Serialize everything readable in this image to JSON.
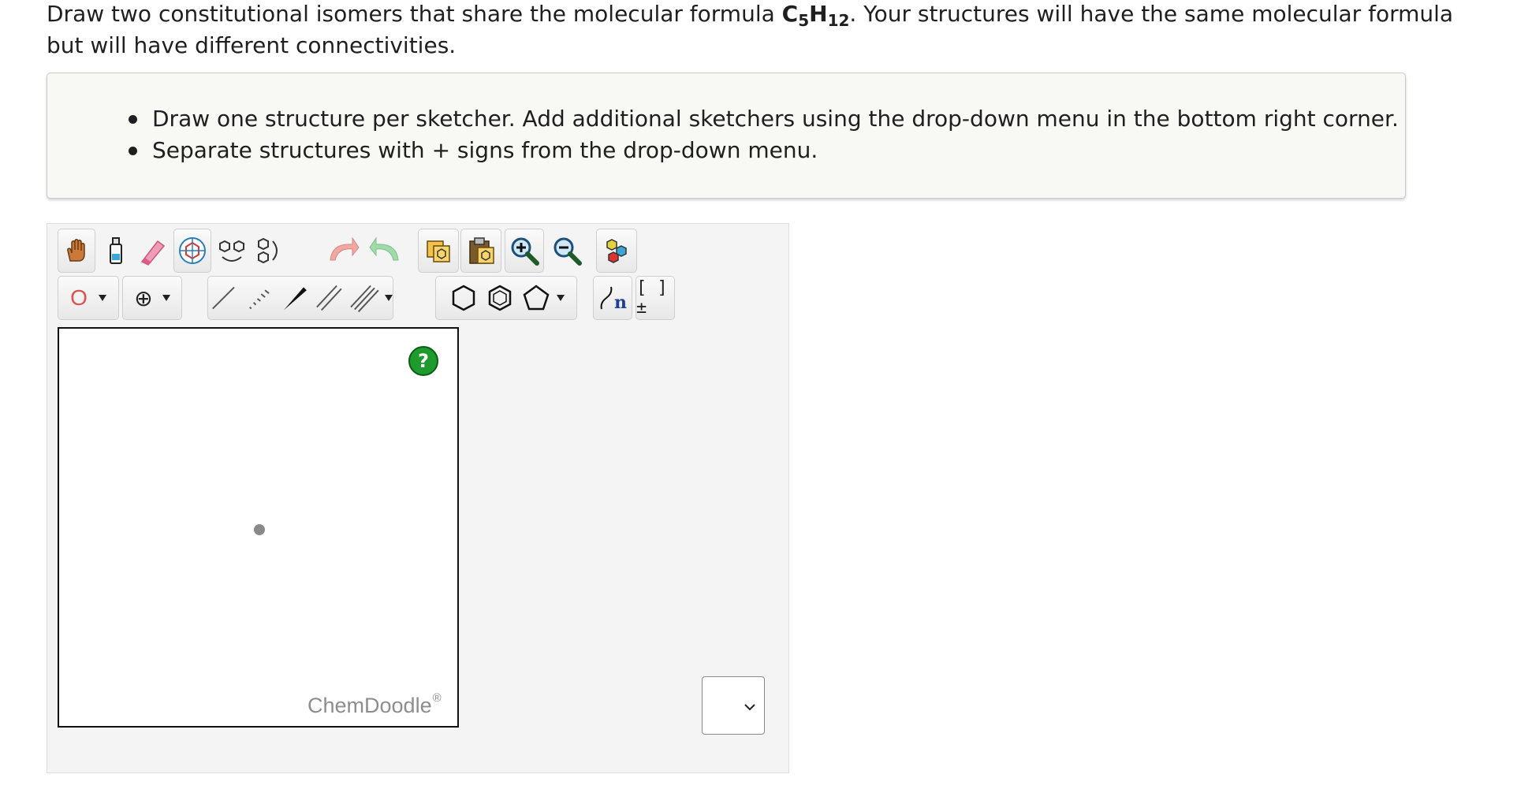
{
  "question": {
    "part1": "Draw two constitutional isomers that share the molecular formula ",
    "formula_c": "C",
    "formula_c_sub": "5",
    "formula_h": "H",
    "formula_h_sub": "12",
    "part2": ". Your structures will have the same molecular formula but will have different connectivities."
  },
  "instructions": [
    "Draw one structure per sketcher. Add additional sketchers using the drop-down menu in the bottom right corner.",
    "Separate structures with + signs from the drop-down menu."
  ],
  "toolbar": {
    "row1": [
      "hand-icon",
      "lasso-bottle-icon",
      "eraser-icon",
      "ring-template-icon",
      "chain-templates-icon",
      "rotate-chain-icon",
      "undo-icon",
      "redo-icon",
      "copy-icon",
      "paste-icon",
      "zoom-in-icon",
      "zoom-out-icon",
      "clean-structure-icon"
    ],
    "atom_label": "O",
    "atom_color": "#d9534f",
    "charge_label": "⊕",
    "bracket_label": "[ ]±",
    "repeat_label": "n"
  },
  "canvas": {
    "help_label": "?",
    "brand": "ChemDoodle",
    "brand_mark": "®"
  },
  "add_sketcher_select": {
    "value": ""
  }
}
